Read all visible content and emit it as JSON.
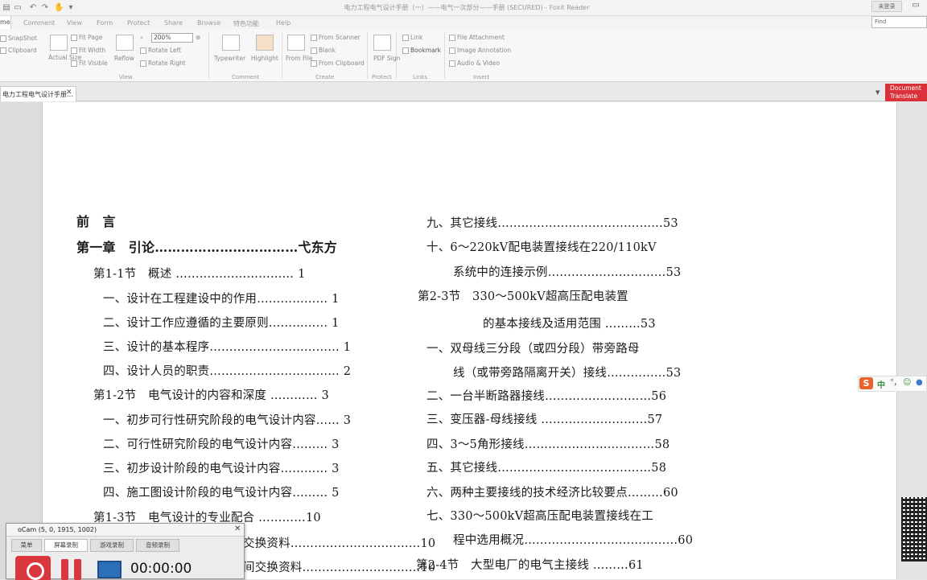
{
  "titlebar": {
    "title": "电力工程电气设计手册（一）——电气一次部分——手册 (SECURED) - Foxit Reader",
    "login": "未登录"
  },
  "menu": {
    "home": "me",
    "items": [
      "Comment",
      "View",
      "Form",
      "Protect",
      "Share",
      "Browse",
      "特色功能",
      "Help"
    ],
    "find_placeholder": "Find"
  },
  "ribbon": {
    "snapshot": "SnapShot",
    "clipboard": "Clipboard",
    "actual_size": "Actual Size",
    "fit_page": "Fit Page",
    "fit_width": "Fit Width",
    "fit_visible": "Fit Visible",
    "reflow": "Reflow",
    "zoom": "200%",
    "rotate_left": "Rotate Left",
    "rotate_right": "Rotate Right",
    "typewriter": "Typewriter",
    "highlight": "Highlight",
    "from_file": "From File",
    "from_scanner": "From Scanner",
    "blank": "Blank",
    "from_clipboard": "From Clipboard",
    "pdf_sign": "PDF Sign",
    "link": "Link",
    "bookmark": "Bookmark",
    "file_attachment": "File Attachment",
    "image_annotation": "Image Annotation",
    "audio_video": "Audio & Video",
    "groups": {
      "view": "View",
      "comment": "Comment",
      "create": "Create",
      "protect": "Protect",
      "links": "Links",
      "insert": "Insert"
    }
  },
  "tabs": {
    "doc_tab": "电力工程电气设计手册…",
    "translate": "Document Translate"
  },
  "toc_left": [
    "前　言",
    "第一章　引论……………………………弋东方",
    "第1-1节　概述 ………………………… 1",
    "一、设计在工程建设中的作用……………… 1",
    "二、设计工作应遵循的主要原则…………… 1",
    "三、设计的基本程序…………………………… 1",
    "四、设计人员的职责…………………………… 2",
    "第1-2节　电气设计的内容和深度 ………… 3",
    "一、初步可行性研究阶段的电气设计内容…… 3",
    "二、可行性研究阶段的电气设计内容……… 3",
    "三、初步设计阶段的电气设计内容………… 3",
    "四、施工图设计阶段的电气设计内容……… 5",
    "第1-3节　电气设计的专业配合 …………10",
    "交换资料……………………………10",
    "间交换资料…………………………10"
  ],
  "toc_right": [
    "九、其它接线……………………………………53",
    "十、6～220kV配电装置接线在220/110kV",
    "系统中的连接示例…………………………53",
    "第2-3节　330～500kV超高压配电装置",
    "的基本接线及适用范围 ………53",
    "一、双母线三分段（或四分段）带旁路母",
    "线（或带旁路隔离开关）接线……………53",
    "二、一台半断路器接线………………………56",
    "三、变压器-母线接线 ………………………57",
    "四、3～5角形接线……………………………58",
    "五、其它接线…………………………………58",
    "六、两种主要接线的技术经济比较要点………60",
    "七、330～500kV超高压配电装置接线在工",
    "程中选用概况…………………………………60",
    "第2-4节　大型电厂的电气主接线 ………61"
  ],
  "ime": {
    "logo": "S",
    "text": "中"
  },
  "ocam": {
    "title": "oCam (5, 0, 1915, 1002)",
    "tabs": [
      "菜单",
      "屏幕录制",
      "游戏录制",
      "音频录制"
    ],
    "time": "00:00:00"
  }
}
